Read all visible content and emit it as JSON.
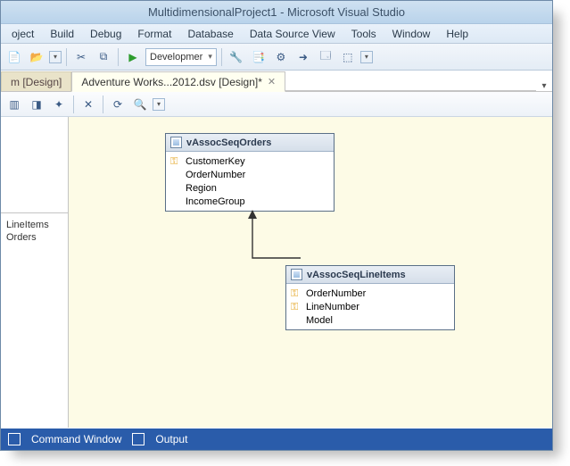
{
  "title": "MultidimensionalProject1 - Microsoft Visual Studio",
  "menu": {
    "items": [
      "oject",
      "Build",
      "Debug",
      "Format",
      "Database",
      "Data Source View",
      "Tools",
      "Window",
      "Help"
    ]
  },
  "toolbar": {
    "config_label": "Developmer"
  },
  "tabs": {
    "t0": {
      "label": "m [Design]"
    },
    "t1": {
      "label": "Adventure Works...2012.dsv [Design]*"
    }
  },
  "side_list": {
    "i0": "LineItems",
    "i1": "Orders"
  },
  "tables": {
    "orders": {
      "name": "vAssocSeqOrders",
      "cols": {
        "c0": "CustomerKey",
        "c1": "OrderNumber",
        "c2": "Region",
        "c3": "IncomeGroup"
      }
    },
    "lines": {
      "name": "vAssocSeqLineItems",
      "cols": {
        "c0": "OrderNumber",
        "c1": "LineNumber",
        "c2": "Model"
      }
    }
  },
  "status": {
    "s0": "Command Window",
    "s1": "Output"
  }
}
